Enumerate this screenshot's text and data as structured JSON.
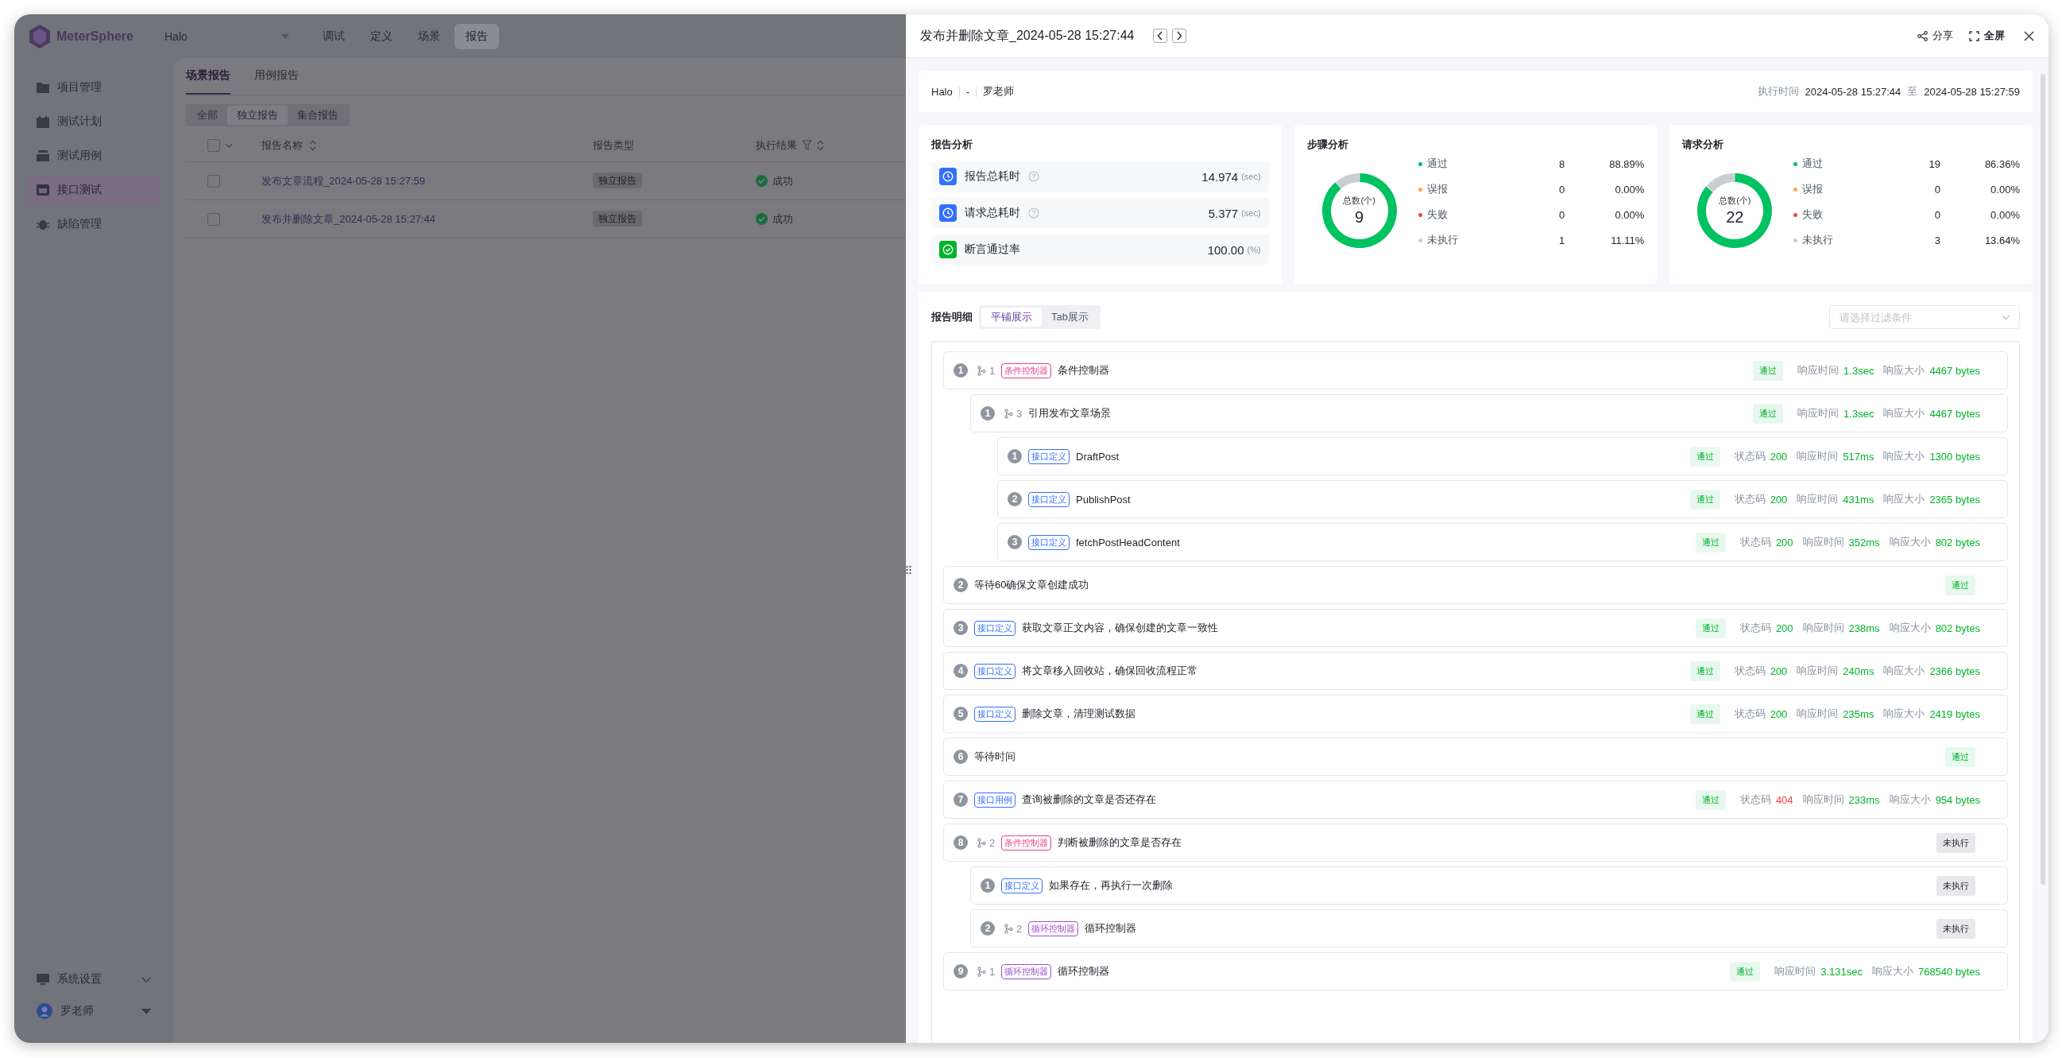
{
  "app": {
    "logo": "MeterSphere",
    "project": "Halo",
    "top_tabs": [
      {
        "label": "调试",
        "selected": false
      },
      {
        "label": "定义",
        "selected": false
      },
      {
        "label": "场景",
        "selected": false
      },
      {
        "label": "报告",
        "selected": true
      }
    ],
    "sidebar": {
      "items": [
        {
          "kind": "folder",
          "label": "项目管理",
          "selected": false
        },
        {
          "kind": "calendar",
          "label": "测试计划",
          "selected": false
        },
        {
          "kind": "stack",
          "label": "测试用例",
          "selected": false
        },
        {
          "kind": "window",
          "label": "接口测试",
          "selected": true
        },
        {
          "kind": "bug",
          "label": "缺陷管理",
          "selected": false
        }
      ],
      "settings": "系统设置",
      "user": "罗老师"
    }
  },
  "report_list": {
    "tabs": [
      {
        "label": "场景报告",
        "selected": true
      },
      {
        "label": "用例报告",
        "selected": false
      }
    ],
    "filters": [
      {
        "label": "全部",
        "selected": false
      },
      {
        "label": "独立报告",
        "selected": true
      },
      {
        "label": "集合报告",
        "selected": false
      }
    ],
    "select_all_checked": false,
    "columns": [
      "报告名称",
      "报告类型",
      "执行结果"
    ],
    "rows": [
      {
        "name": "发布文章流程_2024-05-28 15:27:59",
        "type": "独立报告",
        "result": "成功",
        "checked": false
      },
      {
        "name": "发布并删除文章_2024-05-28 15:27:44",
        "type": "独立报告",
        "result": "成功",
        "checked": false
      }
    ]
  },
  "drawer": {
    "title": "发布并删除文章_2024-05-28 15:27:44",
    "actions": [
      {
        "kind": "share",
        "label": "分享"
      },
      {
        "kind": "fullscreen",
        "label": "全屏"
      }
    ],
    "info": {
      "project": "Halo",
      "separator": "-",
      "user": "罗老师",
      "exec_label": "执行时间",
      "start": "2024-05-28 15:27:44",
      "to": "至",
      "end": "2024-05-28 15:27:59"
    },
    "report_analysis": {
      "title": "报告分析",
      "items": [
        {
          "kind": "clock",
          "label": "报告总耗时",
          "help": true,
          "value": "14.974",
          "unit": "(sec)"
        },
        {
          "kind": "clock",
          "label": "请求总耗时",
          "help": true,
          "value": "5.377",
          "unit": "(sec)"
        },
        {
          "kind": "check",
          "label": "断言通过率",
          "help": false,
          "value": "100.00",
          "unit": "(%)"
        }
      ]
    },
    "step_analysis": {
      "title": "步骤分析",
      "total_label": "总数(个)",
      "total": "9",
      "chart_data": {
        "type": "donut",
        "categories": [
          "通过",
          "误报",
          "失败",
          "未执行"
        ],
        "values": [
          88.89,
          0,
          0,
          11.11
        ]
      },
      "legend": [
        {
          "count": "8",
          "percent": "88.89%",
          "color": "#00c261"
        },
        {
          "count": "0",
          "percent": "0.00%",
          "color": "#ffa940"
        },
        {
          "count": "0",
          "percent": "0.00%",
          "color": "#f53f3f"
        },
        {
          "count": "1",
          "percent": "11.11%",
          "color": "#c9cdd4"
        }
      ]
    },
    "request_analysis": {
      "title": "请求分析",
      "total_label": "总数(个)",
      "total": "22",
      "chart_data": {
        "type": "donut",
        "categories": [
          "通过",
          "误报",
          "失败",
          "未执行"
        ],
        "values": [
          86.36,
          0,
          0,
          13.64
        ]
      },
      "legend": [
        {
          "count": "19",
          "percent": "86.36%",
          "color": "#00c261"
        },
        {
          "count": "0",
          "percent": "0.00%",
          "color": "#ffa940"
        },
        {
          "count": "0",
          "percent": "0.00%",
          "color": "#f53f3f"
        },
        {
          "count": "3",
          "percent": "13.64%",
          "color": "#c9cdd4"
        }
      ]
    },
    "detail": {
      "title": "报告明细",
      "view_tabs": [
        {
          "label": "平铺展示",
          "selected": true
        },
        {
          "label": "Tab展示",
          "selected": false
        }
      ],
      "filter_placeholder": "请选择过滤条件",
      "steps": [
        {
          "index": "1",
          "loop": "1",
          "tag": {
            "kind": "condition",
            "label": "条件控制器"
          },
          "name": "条件控制器",
          "status": {
            "kind": "pass",
            "label": "通过"
          },
          "metrics": [
            {
              "label": "响应时间",
              "value": "1.3sec",
              "kind": "ok"
            },
            {
              "label": "响应大小",
              "value": "4467 bytes",
              "kind": "ok"
            }
          ],
          "children": [
            {
              "index": "1",
              "loop": "3",
              "name": "引用发布文章场景",
              "status": {
                "kind": "pass",
                "label": "通过"
              },
              "metrics": [
                {
                  "label": "响应时间",
                  "value": "1.3sec",
                  "kind": "ok"
                },
                {
                  "label": "响应大小",
                  "value": "4467 bytes",
                  "kind": "ok"
                }
              ],
              "children": [
                {
                  "index": "1",
                  "tag": {
                    "kind": "api",
                    "label": "接口定义"
                  },
                  "name": "DraftPost",
                  "status": {
                    "kind": "pass",
                    "label": "通过"
                  },
                  "metrics": [
                    {
                      "label": "状态码",
                      "value": "200",
                      "kind": "ok"
                    },
                    {
                      "label": "响应时间",
                      "value": "517ms",
                      "kind": "ok"
                    },
                    {
                      "label": "响应大小",
                      "value": "1300 bytes",
                      "kind": "ok"
                    }
                  ]
                },
                {
                  "index": "2",
                  "tag": {
                    "kind": "api",
                    "label": "接口定义"
                  },
                  "name": "PublishPost",
                  "status": {
                    "kind": "pass",
                    "label": "通过"
                  },
                  "metrics": [
                    {
                      "label": "状态码",
                      "value": "200",
                      "kind": "ok"
                    },
                    {
                      "label": "响应时间",
                      "value": "431ms",
                      "kind": "ok"
                    },
                    {
                      "label": "响应大小",
                      "value": "2365 bytes",
                      "kind": "ok"
                    }
                  ]
                },
                {
                  "index": "3",
                  "tag": {
                    "kind": "api",
                    "label": "接口定义"
                  },
                  "name": "fetchPostHeadContent",
                  "status": {
                    "kind": "pass",
                    "label": "通过"
                  },
                  "metrics": [
                    {
                      "label": "状态码",
                      "value": "200",
                      "kind": "ok"
                    },
                    {
                      "label": "响应时间",
                      "value": "352ms",
                      "kind": "ok"
                    },
                    {
                      "label": "响应大小",
                      "value": "802 bytes",
                      "kind": "ok"
                    }
                  ]
                }
              ]
            }
          ]
        },
        {
          "index": "2",
          "name": "等待60确保文章创建成功",
          "status": {
            "kind": "pass",
            "label": "通过"
          }
        },
        {
          "index": "3",
          "tag": {
            "kind": "api",
            "label": "接口定义"
          },
          "name": "获取文章正文内容，确保创建的文章一致性",
          "status": {
            "kind": "pass",
            "label": "通过"
          },
          "metrics": [
            {
              "label": "状态码",
              "value": "200",
              "kind": "ok"
            },
            {
              "label": "响应时间",
              "value": "238ms",
              "kind": "ok"
            },
            {
              "label": "响应大小",
              "value": "802 bytes",
              "kind": "ok"
            }
          ]
        },
        {
          "index": "4",
          "tag": {
            "kind": "api",
            "label": "接口定义"
          },
          "name": "将文章移入回收站，确保回收流程正常",
          "status": {
            "kind": "pass",
            "label": "通过"
          },
          "metrics": [
            {
              "label": "状态码",
              "value": "200",
              "kind": "ok"
            },
            {
              "label": "响应时间",
              "value": "240ms",
              "kind": "ok"
            },
            {
              "label": "响应大小",
              "value": "2366 bytes",
              "kind": "ok"
            }
          ]
        },
        {
          "index": "5",
          "tag": {
            "kind": "api",
            "label": "接口定义"
          },
          "name": "删除文章，清理测试数据",
          "status": {
            "kind": "pass",
            "label": "通过"
          },
          "metrics": [
            {
              "label": "状态码",
              "value": "200",
              "kind": "ok"
            },
            {
              "label": "响应时间",
              "value": "235ms",
              "kind": "ok"
            },
            {
              "label": "响应大小",
              "value": "2419 bytes",
              "kind": "ok"
            }
          ]
        },
        {
          "index": "6",
          "name": "等待时间",
          "status": {
            "kind": "pass",
            "label": "通过"
          }
        },
        {
          "index": "7",
          "tag": {
            "kind": "case",
            "label": "接口用例"
          },
          "name": "查询被删除的文章是否还存在",
          "status": {
            "kind": "pass",
            "label": "通过"
          },
          "metrics": [
            {
              "label": "状态码",
              "value": "404",
              "kind": "error"
            },
            {
              "label": "响应时间",
              "value": "233ms",
              "kind": "ok"
            },
            {
              "label": "响应大小",
              "value": "954 bytes",
              "kind": "ok"
            }
          ]
        },
        {
          "index": "8",
          "loop": "2",
          "tag": {
            "kind": "condition",
            "label": "条件控制器"
          },
          "name": "判断被删除的文章是否存在",
          "status": {
            "kind": "notrun",
            "label": "未执行"
          },
          "children": [
            {
              "index": "1",
              "tag": {
                "kind": "api",
                "label": "接口定义"
              },
              "name": "如果存在，再执行一次删除",
              "status": {
                "kind": "notrun",
                "label": "未执行"
              }
            },
            {
              "index": "2",
              "loop": "2",
              "tag": {
                "kind": "loop",
                "label": "循环控制器"
              },
              "name": "循环控制器",
              "status": {
                "kind": "notrun",
                "label": "未执行"
              }
            }
          ]
        },
        {
          "index": "9",
          "loop": "1",
          "tag": {
            "kind": "loop",
            "label": "循环控制器"
          },
          "name": "循环控制器",
          "status": {
            "kind": "pass",
            "label": "通过"
          },
          "metrics": [
            {
              "label": "响应时间",
              "value": "3.131sec",
              "kind": "ok"
            },
            {
              "label": "响应大小",
              "value": "768540 bytes",
              "kind": "ok"
            }
          ]
        }
      ]
    }
  }
}
